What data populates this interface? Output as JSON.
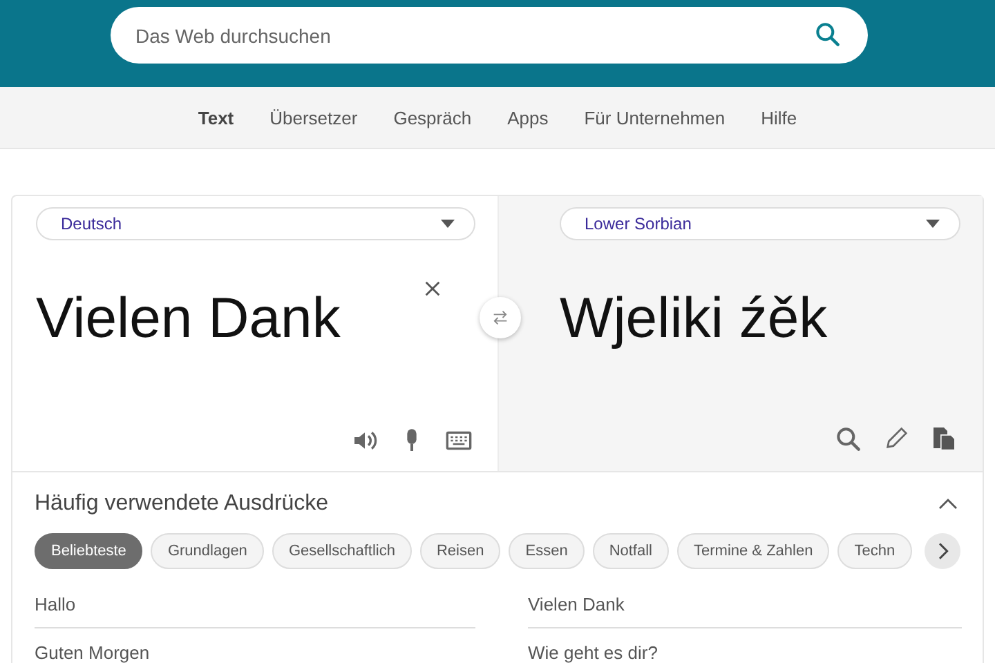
{
  "search": {
    "placeholder": "Das Web durchsuchen"
  },
  "nav": [
    {
      "label": "Text",
      "selected": true
    },
    {
      "label": "Übersetzer",
      "selected": false
    },
    {
      "label": "Gespräch",
      "selected": false
    },
    {
      "label": "Apps",
      "selected": false
    },
    {
      "label": "Für Unternehmen",
      "selected": false
    },
    {
      "label": "Hilfe",
      "selected": false
    }
  ],
  "source": {
    "language": "Deutsch",
    "text": "Vielen Dank"
  },
  "target": {
    "language": "Lower Sorbian",
    "text": "Wjeliki źěk"
  },
  "phrases": {
    "title": "Häufig verwendete Ausdrücke",
    "expanded": true,
    "categories": [
      {
        "label": "Beliebteste",
        "selected": true
      },
      {
        "label": "Grundlagen",
        "selected": false
      },
      {
        "label": "Gesellschaftlich",
        "selected": false
      },
      {
        "label": "Reisen",
        "selected": false
      },
      {
        "label": "Essen",
        "selected": false
      },
      {
        "label": "Notfall",
        "selected": false
      },
      {
        "label": "Termine & Zahlen",
        "selected": false
      },
      {
        "label": "Techn",
        "selected": false
      }
    ],
    "items": [
      "Hallo",
      "Vielen Dank",
      "Guten Morgen",
      "Wie geht es dir?"
    ]
  }
}
